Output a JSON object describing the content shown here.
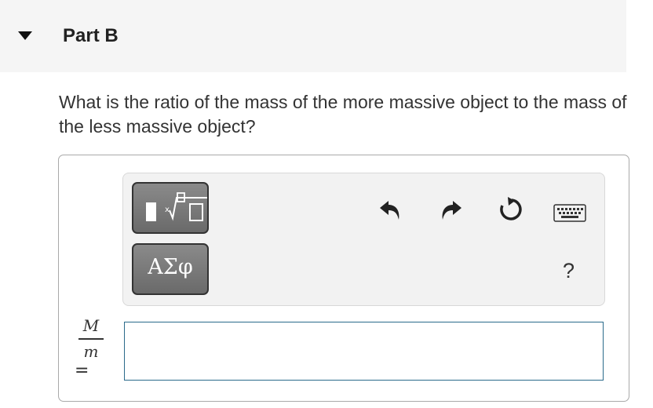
{
  "header": {
    "title": "Part B"
  },
  "question": {
    "text": "What is the ratio of the mass of the more massive object to the mass of the less massive object?"
  },
  "toolbar": {
    "symbols_label": "ΑΣφ",
    "help_label": "?",
    "icons": [
      "templates-icon",
      "undo-icon",
      "redo-icon",
      "reset-icon",
      "keyboard-icon"
    ]
  },
  "answer": {
    "numerator": "M",
    "denominator": "m",
    "equals": "=",
    "value": ""
  },
  "colors": {
    "input_border": "#2a6a8a",
    "button_bg": "#7a7a7a",
    "header_bg": "#f5f5f5"
  }
}
